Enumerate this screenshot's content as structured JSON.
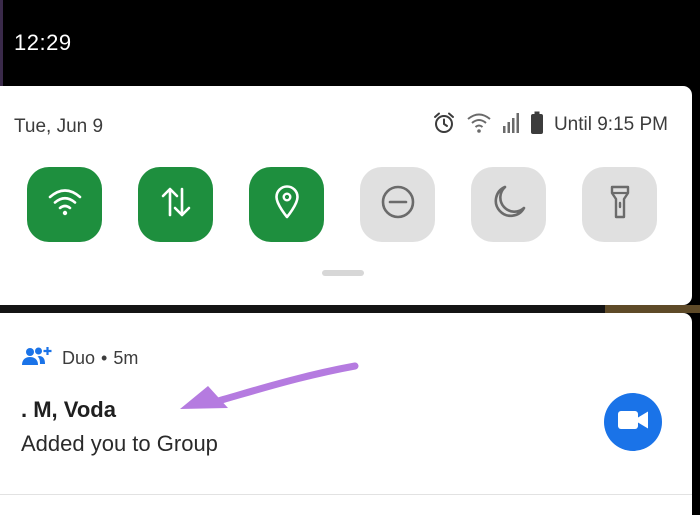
{
  "status_bar": {
    "time": "12:29"
  },
  "quick_settings": {
    "date": "Tue, Jun 9",
    "status_icons": [
      "alarm-icon",
      "wifi-icon",
      "signal-icon",
      "battery-icon"
    ],
    "battery_text": "Until 9:15 PM",
    "tiles": [
      {
        "name": "wifi",
        "icon": "wifi-icon",
        "active": true
      },
      {
        "name": "mobile-data",
        "icon": "up-down-arrows-icon",
        "active": true
      },
      {
        "name": "location",
        "icon": "location-pin-icon",
        "active": true
      },
      {
        "name": "do-not-disturb",
        "icon": "minus-circle-icon",
        "active": false
      },
      {
        "name": "night-mode",
        "icon": "moon-icon",
        "active": false
      },
      {
        "name": "flashlight",
        "icon": "flashlight-icon",
        "active": false
      }
    ]
  },
  "notification": {
    "app_name": "Duo",
    "separator": "•",
    "time_ago": "5m",
    "title": ". M, Voda",
    "body": "Added you to Group",
    "app_icon": "group-add-icon",
    "badge_icon": "video-camera-icon"
  },
  "colors": {
    "active_tile": "#1e8f3e",
    "inactive_tile": "#e0e0e0",
    "duo_blue": "#1a73e8",
    "annotation_arrow": "#b57be0"
  }
}
